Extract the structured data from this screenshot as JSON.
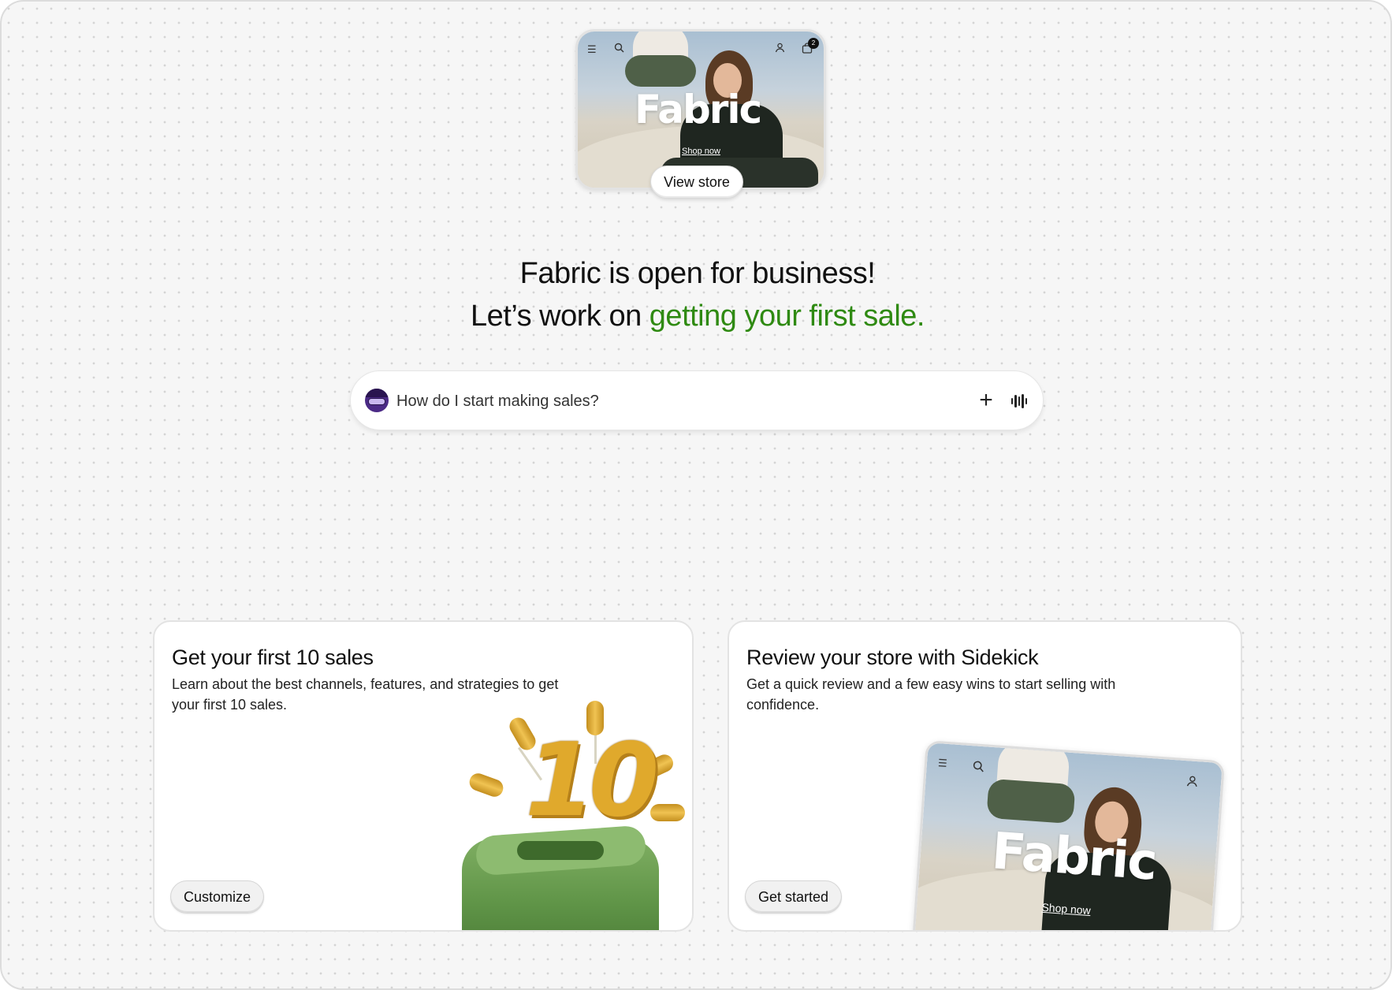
{
  "store": {
    "name": "Fabric",
    "shop_now": "Shop now",
    "cart_count": "2",
    "view_store_label": "View store"
  },
  "headline": {
    "line1": "Fabric is open for business!",
    "line2_prefix": "Let’s work on ",
    "line2_accent": "getting your first sale.",
    "accent_color": "#2f8a12"
  },
  "prompt": {
    "placeholder": "How do I start making sales?",
    "add_icon": "plus-icon",
    "voice_icon": "voice-waveform-icon",
    "avatar_icon": "sidekick-avatar-icon"
  },
  "cards": [
    {
      "title": "Get your first 10 sales",
      "description": "Learn about the best channels, features, and strategies to get your first 10 sales.",
      "button": "Customize",
      "illustration_text": "10"
    },
    {
      "title": "Review your store with Sidekick",
      "description": "Get a quick review and a few easy wins to start selling with confidence.",
      "button": "Get started"
    }
  ],
  "icons": {
    "menu": "menu-icon",
    "search": "search-icon",
    "account": "account-icon",
    "cart": "cart-icon"
  }
}
